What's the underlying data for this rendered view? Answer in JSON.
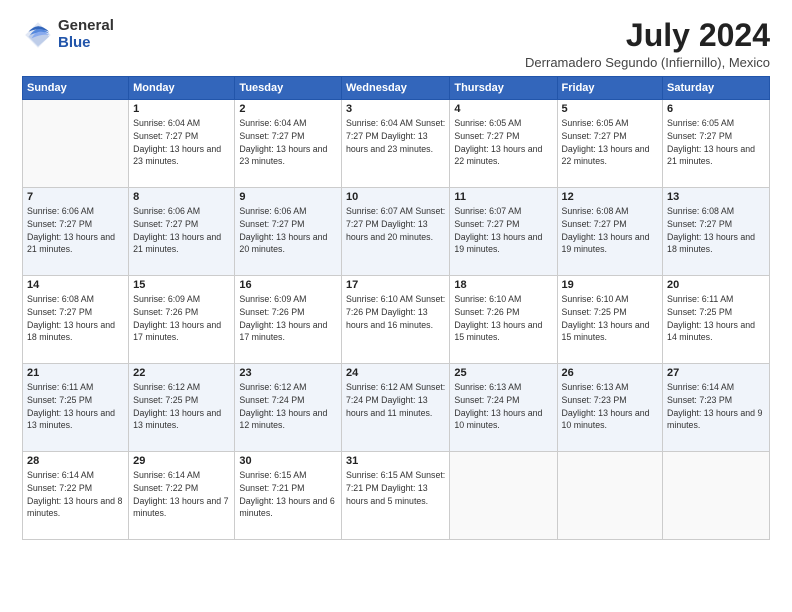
{
  "header": {
    "logo_general": "General",
    "logo_blue": "Blue",
    "month_title": "July 2024",
    "location": "Derramadero Segundo (Infiernillo), Mexico"
  },
  "days_of_week": [
    "Sunday",
    "Monday",
    "Tuesday",
    "Wednesday",
    "Thursday",
    "Friday",
    "Saturday"
  ],
  "weeks": [
    [
      {
        "day": "",
        "info": ""
      },
      {
        "day": "1",
        "info": "Sunrise: 6:04 AM\nSunset: 7:27 PM\nDaylight: 13 hours\nand 23 minutes."
      },
      {
        "day": "2",
        "info": "Sunrise: 6:04 AM\nSunset: 7:27 PM\nDaylight: 13 hours\nand 23 minutes."
      },
      {
        "day": "3",
        "info": "Sunrise: 6:04 AM\nSunset: 7:27 PM\nDaylight: 13 hours\nand 23 minutes."
      },
      {
        "day": "4",
        "info": "Sunrise: 6:05 AM\nSunset: 7:27 PM\nDaylight: 13 hours\nand 22 minutes."
      },
      {
        "day": "5",
        "info": "Sunrise: 6:05 AM\nSunset: 7:27 PM\nDaylight: 13 hours\nand 22 minutes."
      },
      {
        "day": "6",
        "info": "Sunrise: 6:05 AM\nSunset: 7:27 PM\nDaylight: 13 hours\nand 21 minutes."
      }
    ],
    [
      {
        "day": "7",
        "info": "Sunrise: 6:06 AM\nSunset: 7:27 PM\nDaylight: 13 hours\nand 21 minutes."
      },
      {
        "day": "8",
        "info": "Sunrise: 6:06 AM\nSunset: 7:27 PM\nDaylight: 13 hours\nand 21 minutes."
      },
      {
        "day": "9",
        "info": "Sunrise: 6:06 AM\nSunset: 7:27 PM\nDaylight: 13 hours\nand 20 minutes."
      },
      {
        "day": "10",
        "info": "Sunrise: 6:07 AM\nSunset: 7:27 PM\nDaylight: 13 hours\nand 20 minutes."
      },
      {
        "day": "11",
        "info": "Sunrise: 6:07 AM\nSunset: 7:27 PM\nDaylight: 13 hours\nand 19 minutes."
      },
      {
        "day": "12",
        "info": "Sunrise: 6:08 AM\nSunset: 7:27 PM\nDaylight: 13 hours\nand 19 minutes."
      },
      {
        "day": "13",
        "info": "Sunrise: 6:08 AM\nSunset: 7:27 PM\nDaylight: 13 hours\nand 18 minutes."
      }
    ],
    [
      {
        "day": "14",
        "info": "Sunrise: 6:08 AM\nSunset: 7:27 PM\nDaylight: 13 hours\nand 18 minutes."
      },
      {
        "day": "15",
        "info": "Sunrise: 6:09 AM\nSunset: 7:26 PM\nDaylight: 13 hours\nand 17 minutes."
      },
      {
        "day": "16",
        "info": "Sunrise: 6:09 AM\nSunset: 7:26 PM\nDaylight: 13 hours\nand 17 minutes."
      },
      {
        "day": "17",
        "info": "Sunrise: 6:10 AM\nSunset: 7:26 PM\nDaylight: 13 hours\nand 16 minutes."
      },
      {
        "day": "18",
        "info": "Sunrise: 6:10 AM\nSunset: 7:26 PM\nDaylight: 13 hours\nand 15 minutes."
      },
      {
        "day": "19",
        "info": "Sunrise: 6:10 AM\nSunset: 7:25 PM\nDaylight: 13 hours\nand 15 minutes."
      },
      {
        "day": "20",
        "info": "Sunrise: 6:11 AM\nSunset: 7:25 PM\nDaylight: 13 hours\nand 14 minutes."
      }
    ],
    [
      {
        "day": "21",
        "info": "Sunrise: 6:11 AM\nSunset: 7:25 PM\nDaylight: 13 hours\nand 13 minutes."
      },
      {
        "day": "22",
        "info": "Sunrise: 6:12 AM\nSunset: 7:25 PM\nDaylight: 13 hours\nand 13 minutes."
      },
      {
        "day": "23",
        "info": "Sunrise: 6:12 AM\nSunset: 7:24 PM\nDaylight: 13 hours\nand 12 minutes."
      },
      {
        "day": "24",
        "info": "Sunrise: 6:12 AM\nSunset: 7:24 PM\nDaylight: 13 hours\nand 11 minutes."
      },
      {
        "day": "25",
        "info": "Sunrise: 6:13 AM\nSunset: 7:24 PM\nDaylight: 13 hours\nand 10 minutes."
      },
      {
        "day": "26",
        "info": "Sunrise: 6:13 AM\nSunset: 7:23 PM\nDaylight: 13 hours\nand 10 minutes."
      },
      {
        "day": "27",
        "info": "Sunrise: 6:14 AM\nSunset: 7:23 PM\nDaylight: 13 hours\nand 9 minutes."
      }
    ],
    [
      {
        "day": "28",
        "info": "Sunrise: 6:14 AM\nSunset: 7:22 PM\nDaylight: 13 hours\nand 8 minutes."
      },
      {
        "day": "29",
        "info": "Sunrise: 6:14 AM\nSunset: 7:22 PM\nDaylight: 13 hours\nand 7 minutes."
      },
      {
        "day": "30",
        "info": "Sunrise: 6:15 AM\nSunset: 7:21 PM\nDaylight: 13 hours\nand 6 minutes."
      },
      {
        "day": "31",
        "info": "Sunrise: 6:15 AM\nSunset: 7:21 PM\nDaylight: 13 hours\nand 5 minutes."
      },
      {
        "day": "",
        "info": ""
      },
      {
        "day": "",
        "info": ""
      },
      {
        "day": "",
        "info": ""
      }
    ]
  ]
}
